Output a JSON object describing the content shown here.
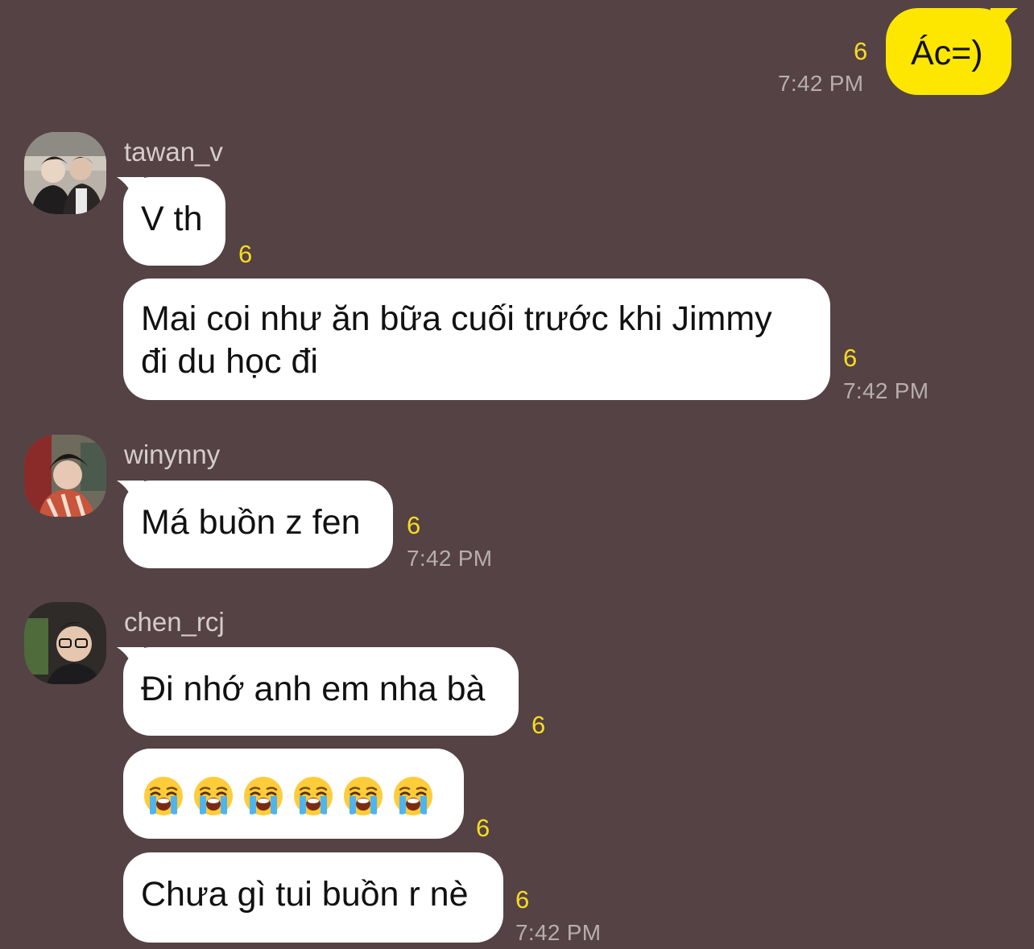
{
  "accent_colors": {
    "background": "#544244",
    "my_bubble": "#fde600",
    "other_bubble": "#ffffff",
    "unread_count": "#f7dc21"
  },
  "messages": {
    "m1": {
      "sender": "me",
      "text": "Ác=)",
      "unread": "6",
      "time": "7:42 PM"
    },
    "g1": {
      "sender": "tawan_v",
      "avatar_icon": "profile-photo-avatar",
      "m1": {
        "text": "V th",
        "unread": "6"
      },
      "m2": {
        "text_line1": "Mai coi như ăn bữa cuối trước khi Jimmy",
        "text_line2": "đi du học đi",
        "unread": "6",
        "time": "7:42 PM"
      }
    },
    "g2": {
      "sender": "winynny",
      "avatar_icon": "profile-photo-avatar",
      "m1": {
        "text": "Má buồn z fen",
        "unread": "6",
        "time": "7:42 PM"
      }
    },
    "g3": {
      "sender": "chen_rcj",
      "avatar_icon": "profile-photo-avatar",
      "m1": {
        "text": "Đi nhớ anh em nha bà",
        "unread": "6"
      },
      "m2": {
        "emoji_icon": "loudly-crying-face-icon",
        "emoji_count": 6,
        "unread": "6"
      },
      "m3": {
        "text": "Chưa gì tui buồn r nè",
        "unread": "6",
        "time": "7:42 PM"
      }
    }
  }
}
